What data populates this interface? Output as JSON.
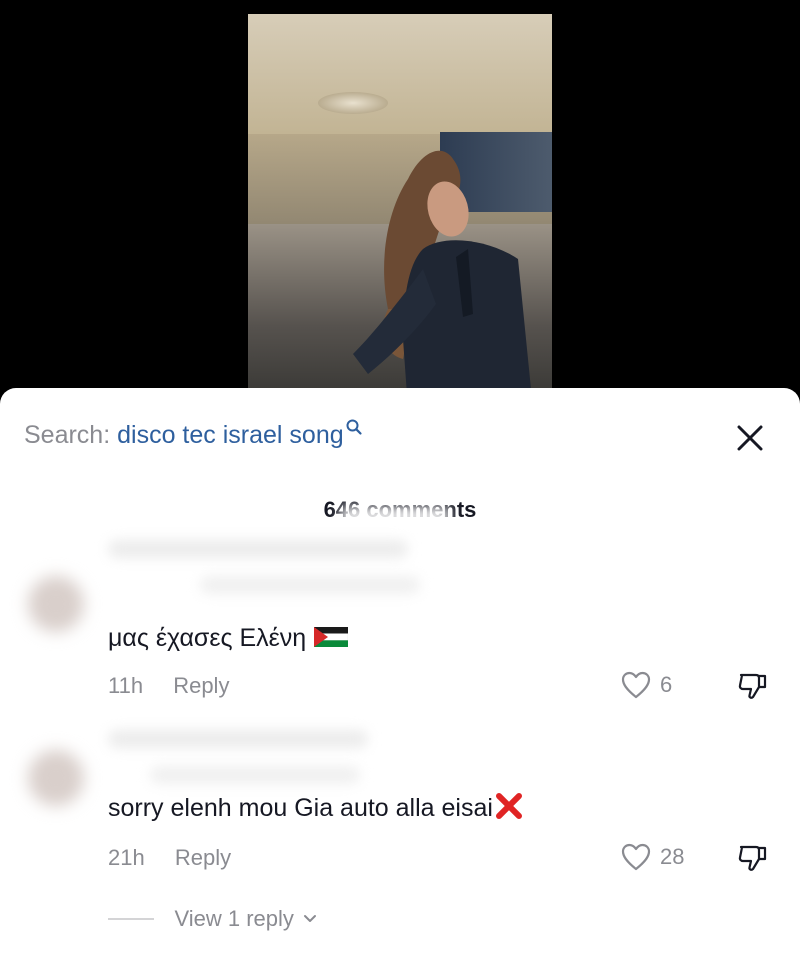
{
  "video": {
    "description_icon": "video-thumbnail"
  },
  "search": {
    "label": "Search:",
    "query": "disco tec israel song",
    "icon": "search-icon"
  },
  "header": {
    "close_icon": "close-icon",
    "comment_count": "646 comments"
  },
  "comments": [
    {
      "text": "μας έχασες Ελένη",
      "emoji": "palestine-flag",
      "time": "11h",
      "reply_label": "Reply",
      "likes": "6"
    },
    {
      "text": "sorry elenh mou Gia auto alla eisai",
      "emoji": "red-x-mark",
      "time": "21h",
      "reply_label": "Reply",
      "likes": "28"
    }
  ],
  "view_replies": {
    "label": "View 1 reply"
  },
  "colors": {
    "accent_query": "#2e5f9e",
    "text_primary": "#161823",
    "text_secondary": "#8a8b91"
  }
}
